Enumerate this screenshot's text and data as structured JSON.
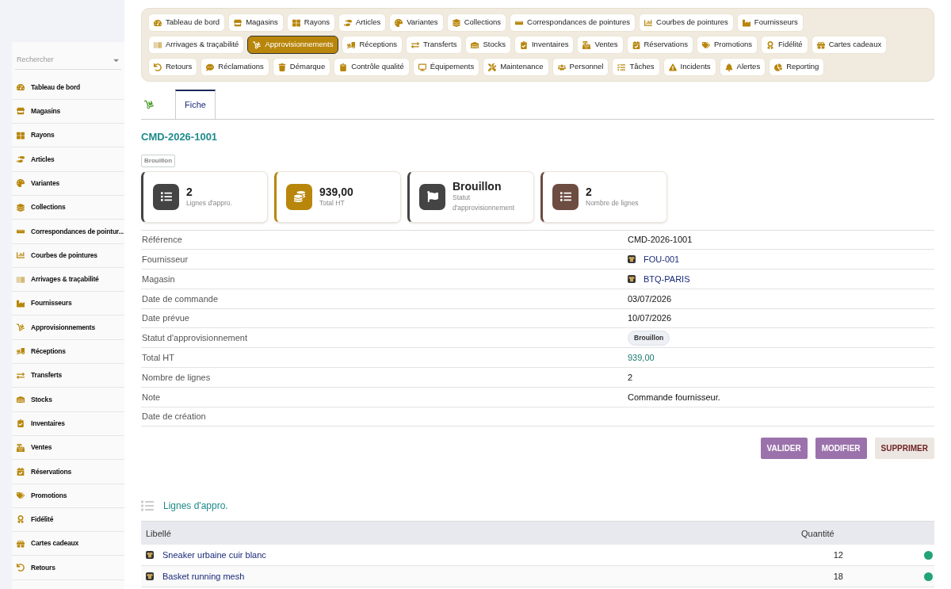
{
  "sidebar": {
    "search": {
      "placeholder": "Rechercher"
    },
    "items": [
      {
        "label": "Tableau de bord",
        "selected": false
      },
      {
        "label": "Magasins",
        "selected": false
      },
      {
        "label": "Rayons",
        "selected": false
      },
      {
        "label": "Articles",
        "selected": false
      },
      {
        "label": "Variantes",
        "selected": false
      },
      {
        "label": "Collections",
        "selected": false
      },
      {
        "label": "Correspondances de pointur...",
        "selected": false
      },
      {
        "label": "Courbes de pointures",
        "selected": false
      },
      {
        "label": "Arrivages & traçabilité",
        "selected": false
      },
      {
        "label": "Fournisseurs",
        "selected": false
      },
      {
        "label": "Approvisionnements",
        "selected": false
      },
      {
        "label": "Réceptions",
        "selected": false
      },
      {
        "label": "Transferts",
        "selected": false
      },
      {
        "label": "Stocks",
        "selected": false
      },
      {
        "label": "Inventaires",
        "selected": false
      },
      {
        "label": "Ventes",
        "selected": false
      },
      {
        "label": "Réservations",
        "selected": false
      },
      {
        "label": "Promotions",
        "selected": false
      },
      {
        "label": "Fidélité",
        "selected": false
      },
      {
        "label": "Cartes cadeaux",
        "selected": false
      },
      {
        "label": "Retours",
        "selected": false
      }
    ]
  },
  "nav": [
    {
      "label": "Tableau de bord",
      "selected": false
    },
    {
      "label": "Magasins",
      "selected": false
    },
    {
      "label": "Rayons",
      "selected": false
    },
    {
      "label": "Articles",
      "selected": false
    },
    {
      "label": "Variantes",
      "selected": false
    },
    {
      "label": "Collections",
      "selected": false
    },
    {
      "label": "Correspondances de pointures",
      "selected": false
    },
    {
      "label": "Courbes de pointures",
      "selected": false
    },
    {
      "label": "Fournisseurs",
      "selected": false
    },
    {
      "label": "Arrivages & traçabilité",
      "selected": false
    },
    {
      "label": "Approvisionnements",
      "selected": true
    },
    {
      "label": "Réceptions",
      "selected": false
    },
    {
      "label": "Transferts",
      "selected": false
    },
    {
      "label": "Stocks",
      "selected": false
    },
    {
      "label": "Inventaires",
      "selected": false
    },
    {
      "label": "Ventes",
      "selected": false
    },
    {
      "label": "Réservations",
      "selected": false
    },
    {
      "label": "Promotions",
      "selected": false
    },
    {
      "label": "Fidélité",
      "selected": false
    },
    {
      "label": "Cartes cadeaux",
      "selected": false
    },
    {
      "label": "Retours",
      "selected": false
    },
    {
      "label": "Réclamations",
      "selected": false
    },
    {
      "label": "Démarque",
      "selected": false
    },
    {
      "label": "Contrôle qualité",
      "selected": false
    },
    {
      "label": "Équipements",
      "selected": false
    },
    {
      "label": "Maintenance",
      "selected": false
    },
    {
      "label": "Personnel",
      "selected": false
    },
    {
      "label": "Tâches",
      "selected": false
    },
    {
      "label": "Incidents",
      "selected": false
    },
    {
      "label": "Alertes",
      "selected": false
    },
    {
      "label": "Reporting",
      "selected": false
    }
  ],
  "tabs": [
    {
      "label": "Fiche",
      "selected": true
    }
  ],
  "record": {
    "title": "CMD-2026-1001",
    "status": "Brouillon"
  },
  "cards": [
    {
      "value": "2",
      "label": "Lignes d'appro.",
      "color": "#444444"
    },
    {
      "value": "939,00",
      "label": "Total HT",
      "color": "#b8860b"
    },
    {
      "value": "Brouillon",
      "label": "Statut d'approvisionnement",
      "color": "#444444"
    },
    {
      "value": "2",
      "label": "Nombre de lignes",
      "color": "#6d4c41"
    }
  ],
  "fields": [
    {
      "label": "Référence",
      "value": "CMD-2026-1001",
      "kind": "text"
    },
    {
      "label": "Fournisseur",
      "value": "FOU-001",
      "kind": "link"
    },
    {
      "label": "Magasin",
      "value": "BTQ-PARIS",
      "kind": "link"
    },
    {
      "label": "Date de commande",
      "value": "03/07/2026",
      "kind": "text"
    },
    {
      "label": "Date prévue",
      "value": "10/07/2026",
      "kind": "text"
    },
    {
      "label": "Statut d'approvisionnement",
      "value": "Brouillon",
      "kind": "badge"
    },
    {
      "label": "Total HT",
      "value": "939,00",
      "kind": "amount"
    },
    {
      "label": "Nombre de lignes",
      "value": "2",
      "kind": "text"
    },
    {
      "label": "Note",
      "value": "Commande fournisseur.",
      "kind": "text"
    },
    {
      "label": "Date de création",
      "kind": "text"
    }
  ],
  "buttons": [
    {
      "label": "VALIDER",
      "kind": "primary"
    },
    {
      "label": "MODIFIER",
      "kind": "primary"
    },
    {
      "label": "SUPPRIMER",
      "kind": "danger"
    }
  ],
  "lines": {
    "title": "Lignes d'appro.",
    "columns": [
      "Libellé",
      "Quantité"
    ],
    "rows": [
      {
        "label": "Sneaker urbaine cuir blanc",
        "quantity": "12",
        "color": "#22a37a"
      },
      {
        "label": "Basket running mesh",
        "quantity": "18",
        "color": "#22a37a"
      }
    ]
  }
}
